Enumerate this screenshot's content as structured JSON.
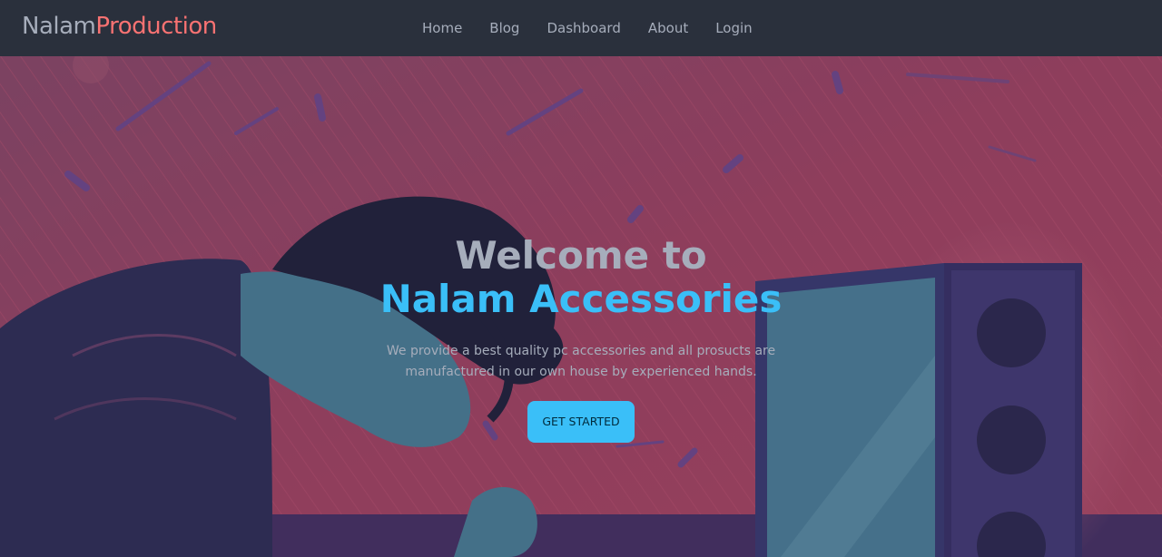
{
  "brand": {
    "part1": "Nalam",
    "part2": "Production"
  },
  "nav": {
    "items": [
      {
        "label": "Home"
      },
      {
        "label": "Blog"
      },
      {
        "label": "Dashboard"
      },
      {
        "label": "About"
      },
      {
        "label": "Login"
      }
    ]
  },
  "hero": {
    "title_line1": "Welcome to",
    "title_line2": "Nalam Accessories",
    "description": "We provide a best quality pc accessories and all prosucts are manufactured in our own house by experienced hands.",
    "cta_label": "GET STARTED"
  },
  "colors": {
    "navbar_bg": "#2a303c",
    "text_muted": "#a6adbb",
    "brand_accent": "#f87272",
    "primary": "#3abff8",
    "hero_bg": "#a8405f"
  }
}
